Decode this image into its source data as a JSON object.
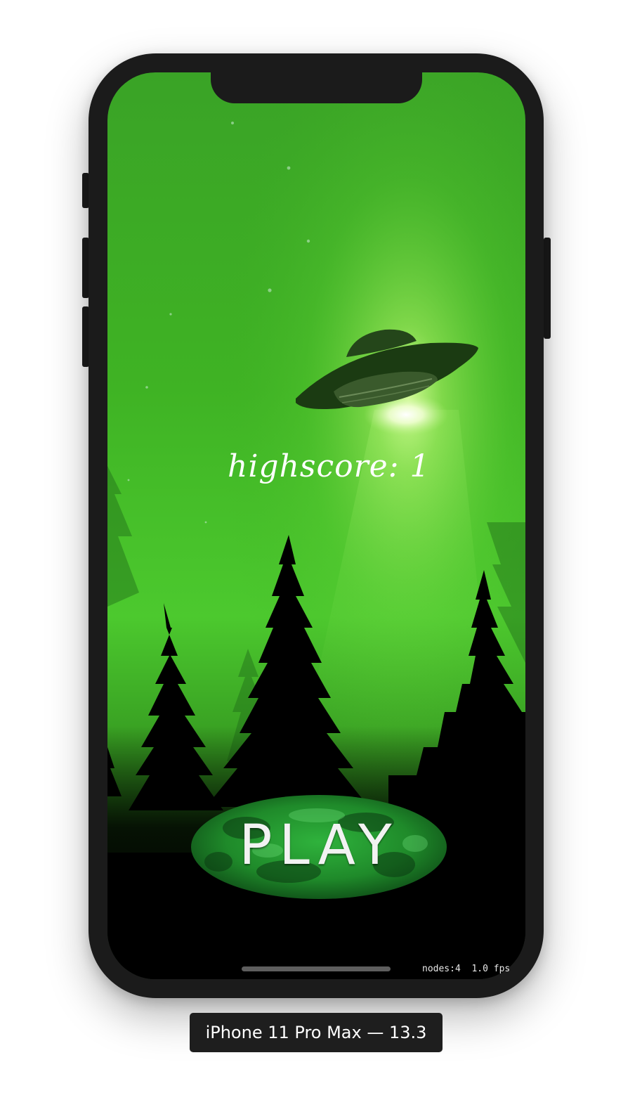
{
  "game": {
    "highscore_label": "highscore: 1",
    "play_label": "PLAY"
  },
  "debug_overlay": {
    "text": "nodes:4  1.0 fps"
  },
  "simulator": {
    "device_label": "iPhone 11 Pro Max — 13.3"
  },
  "colors": {
    "sky_green": "#3fae24",
    "glow_green": "#7bdc46",
    "tree_black": "#000000",
    "button_green": "#1f8a2a",
    "frame": "#1b1b1b"
  },
  "icons": [
    "ufo-icon",
    "trees-silhouette"
  ]
}
